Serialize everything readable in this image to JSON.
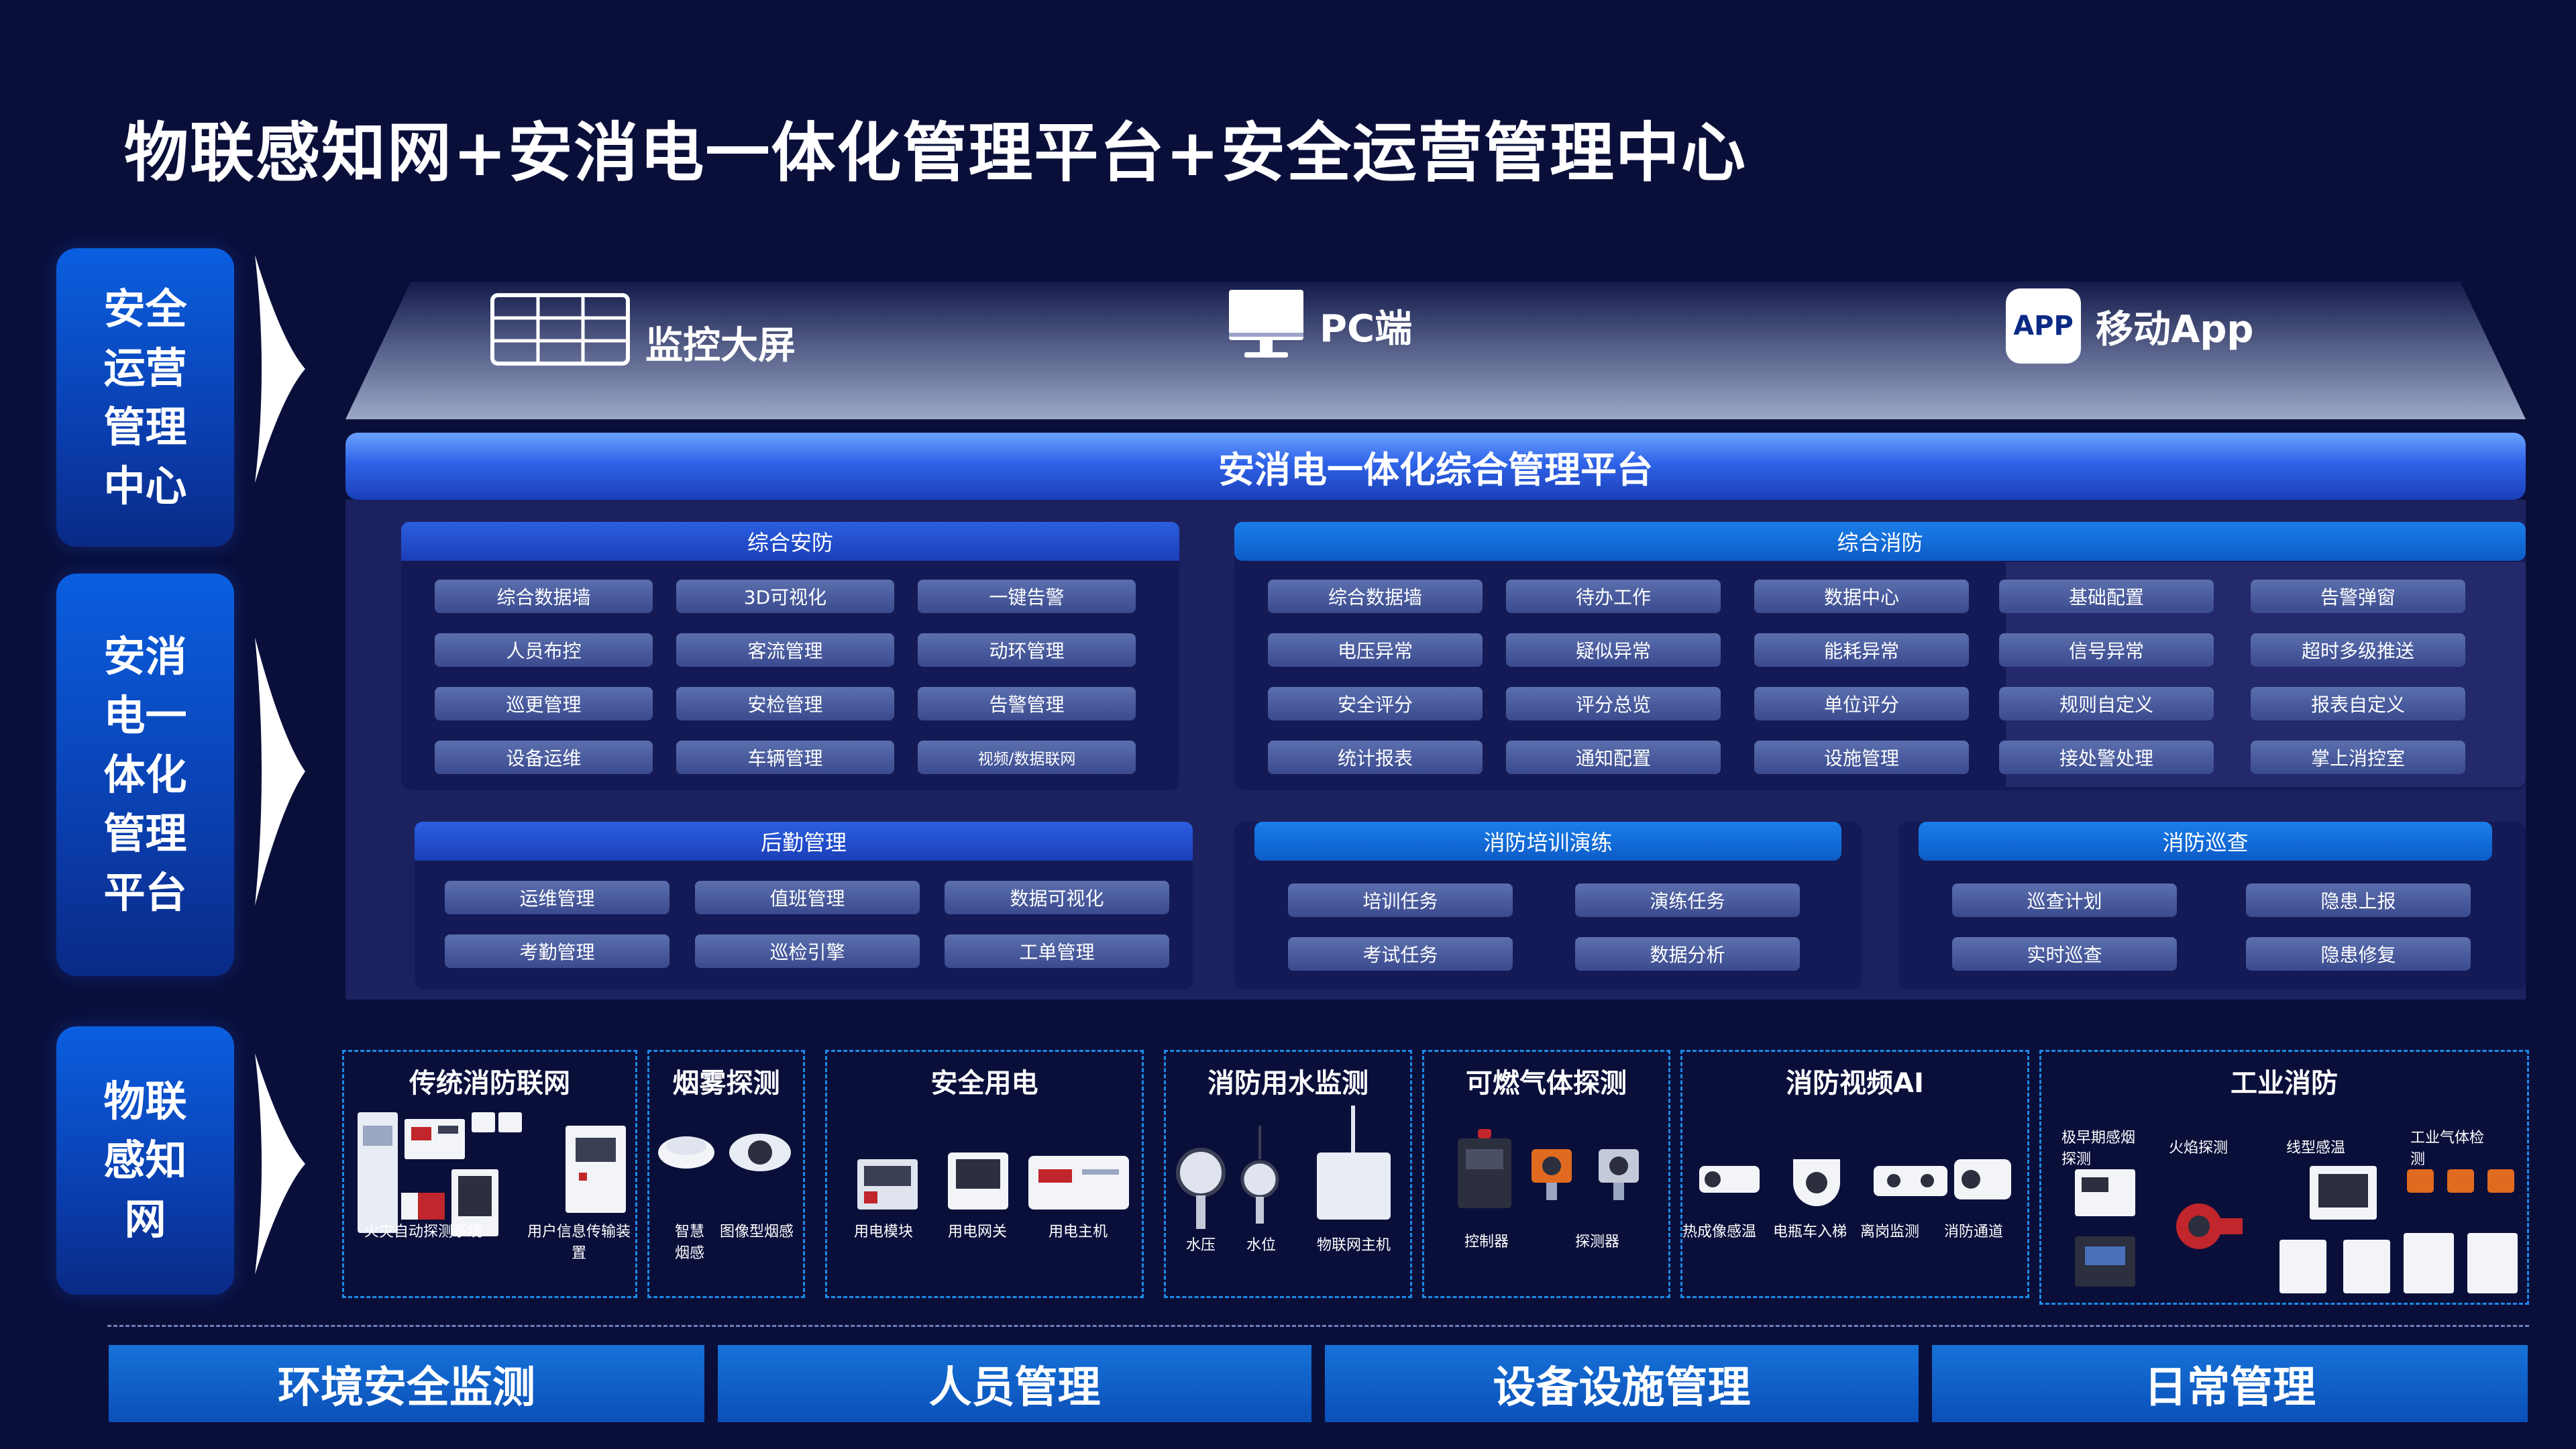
{
  "title": "物联感知网+安消电一体化管理平台+安全运营管理中心",
  "tiers": {
    "ops": "安全运营管理中心",
    "platform": "安消电一体化管理平台",
    "iot": "物联感知网"
  },
  "access": {
    "screen": "监控大屏",
    "pc": "PC端",
    "app_badge": "APP",
    "app": "移动App"
  },
  "platform_title": "安消电一体化综合管理平台",
  "modules": {
    "security": {
      "title": "综合安防",
      "items": [
        "综合数据墙",
        "3D可视化",
        "一键告警",
        "人员布控",
        "客流管理",
        "动环管理",
        "巡更管理",
        "安检管理",
        "告警管理",
        "设备运维",
        "车辆管理",
        "视频/数据联网"
      ]
    },
    "fire": {
      "title": "综合消防",
      "items": [
        "综合数据墙",
        "待办工作",
        "数据中心",
        "基础配置",
        "告警弹窗",
        "电压异常",
        "疑似异常",
        "能耗异常",
        "信号异常",
        "超时多级推送",
        "安全评分",
        "评分总览",
        "单位评分",
        "规则自定义",
        "报表自定义",
        "统计报表",
        "通知配置",
        "设施管理",
        "接处警处理",
        "掌上消控室"
      ]
    },
    "logistics": {
      "title": "后勤管理",
      "items": [
        "运维管理",
        "值班管理",
        "数据可视化",
        "考勤管理",
        "巡检引擎",
        "工单管理"
      ]
    },
    "training": {
      "title": "消防培训演练",
      "items": [
        "培训任务",
        "演练任务",
        "考试任务",
        "数据分析"
      ]
    },
    "patrol": {
      "title": "消防巡查",
      "items": [
        "巡查计划",
        "隐患上报",
        "实时巡查",
        "隐患修复"
      ]
    }
  },
  "iot": [
    {
      "title": "传统消防联网",
      "labels": [
        "火灾自动探测系统",
        "用户信息传输装置"
      ]
    },
    {
      "title": "烟雾探测",
      "labels": [
        "智慧烟感",
        "图像型烟感"
      ]
    },
    {
      "title": "安全用电",
      "labels": [
        "用电模块",
        "用电网关",
        "用电主机"
      ]
    },
    {
      "title": "消防用水监测",
      "labels": [
        "水压",
        "水位",
        "物联网主机"
      ]
    },
    {
      "title": "可燃气体探测",
      "labels": [
        "控制器",
        "探测器"
      ]
    },
    {
      "title": "消防视频AI",
      "labels": [
        "热成像感温",
        "电瓶车入梯",
        "离岗监测",
        "消防通道"
      ]
    },
    {
      "title": "工业消防",
      "labels": [
        "极早期感烟探测",
        "火焰探测",
        "线型感温",
        "工业气体检测"
      ]
    }
  ],
  "bottom": [
    "环境安全监测",
    "人员管理",
    "设备设施管理",
    "日常管理"
  ],
  "colors": {
    "background": "#0a0f3a",
    "accent": "#1672d8",
    "pill": "#4a5a9e"
  }
}
